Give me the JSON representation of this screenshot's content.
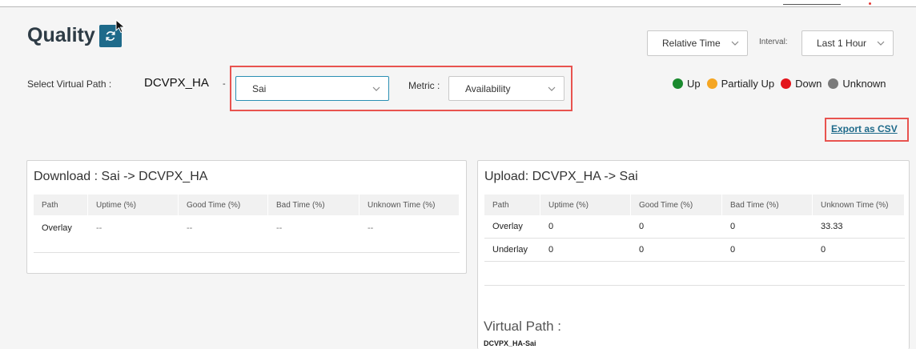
{
  "header": {
    "title": "Quality"
  },
  "time_controls": {
    "relative_time": "Relative Time",
    "interval_label": "Interval:",
    "interval_value": "Last 1 Hour"
  },
  "selector": {
    "virtual_path_label": "Select Virtual Path :",
    "site_name": "DCVPX_HA",
    "separator": "-",
    "path_value": "Sai",
    "metric_label": "Metric :",
    "metric_value": "Availability"
  },
  "legend": {
    "items": [
      {
        "label": "Up",
        "color": "#1a8a2e"
      },
      {
        "label": "Partially Up",
        "color": "#f5a623"
      },
      {
        "label": "Down",
        "color": "#e3141b"
      },
      {
        "label": "Unknown",
        "color": "#7a7a7a"
      }
    ]
  },
  "export": {
    "label": "Export as CSV"
  },
  "download_panel": {
    "title": "Download : Sai -> DCVPX_HA",
    "columns": [
      "Path",
      "Uptime (%)",
      "Good Time (%)",
      "Bad Time (%)",
      "Unknown Time (%)"
    ],
    "rows": [
      [
        "Overlay",
        "--",
        "--",
        "--",
        "--"
      ]
    ]
  },
  "upload_panel": {
    "title": "Upload: DCVPX_HA -> Sai",
    "columns": [
      "Path",
      "Uptime (%)",
      "Good Time (%)",
      "Bad Time (%)",
      "Unknown Time (%)"
    ],
    "rows": [
      [
        "Overlay",
        "0",
        "0",
        "0",
        "33.33"
      ],
      [
        "Underlay",
        "0",
        "0",
        "0",
        "0"
      ]
    ]
  },
  "virtual_path": {
    "label": "Virtual Path :",
    "value": "DCVPX_HA-Sai"
  }
}
